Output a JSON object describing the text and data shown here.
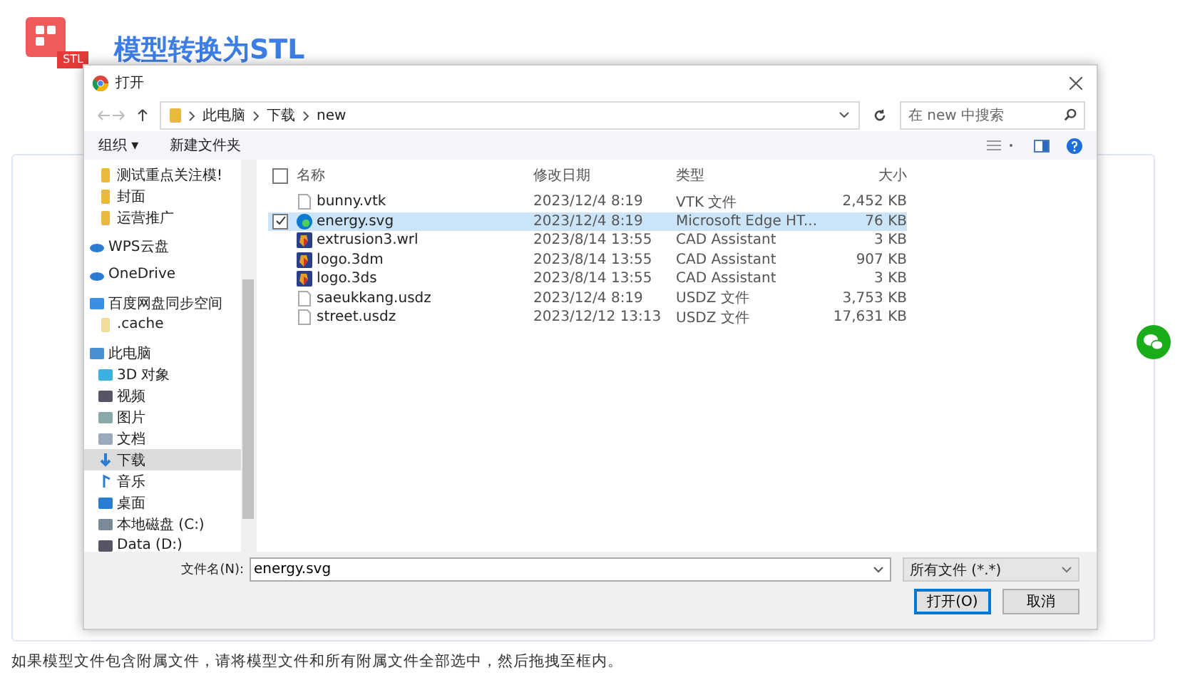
{
  "header": {
    "badge": "STL",
    "title": "模型转换为STL"
  },
  "dialog": {
    "title": "打开",
    "breadcrumb": [
      "此电脑",
      "下载",
      "new"
    ],
    "search": {
      "placeholder": "在 new 中搜索"
    },
    "toolbar": [
      "组织 ▾",
      "新建文件夹"
    ],
    "sidebar": [
      {
        "label": "测试重点关注模!",
        "kind": "folder",
        "selected": false
      },
      {
        "label": "封面",
        "kind": "folder",
        "selected": false
      },
      {
        "label": "运营推广",
        "kind": "folder",
        "selected": false
      },
      {
        "label": "WPS云盘",
        "kind": "cloud",
        "selected": false
      },
      {
        "label": "OneDrive",
        "kind": "cloud",
        "selected": false
      },
      {
        "label": "百度网盘同步空间",
        "kind": "sync",
        "selected": false,
        "children": [
          {
            "label": ".cache",
            "kind": "folder-light",
            "selected": false
          }
        ]
      },
      {
        "label": "此电脑",
        "kind": "pc",
        "selected": false,
        "children": [
          {
            "label": "3D 对象",
            "kind": "cube",
            "selected": false
          },
          {
            "label": "视频",
            "kind": "video",
            "selected": false
          },
          {
            "label": "图片",
            "kind": "image",
            "selected": false
          },
          {
            "label": "文档",
            "kind": "doc",
            "selected": false
          },
          {
            "label": "下载",
            "kind": "download",
            "selected": true
          },
          {
            "label": "音乐",
            "kind": "music",
            "selected": false
          },
          {
            "label": "桌面",
            "kind": "desktop",
            "selected": false
          },
          {
            "label": "本地磁盘 (C:)",
            "kind": "disk",
            "selected": false
          },
          {
            "label": "Data (D:)",
            "kind": "drive",
            "selected": false
          }
        ]
      }
    ],
    "all_checked": false,
    "columns": [
      "名称",
      "修改日期",
      "类型",
      "大小"
    ],
    "files": [
      {
        "name": "bunny.vtk",
        "date": "2023/12/4 8:19",
        "type": "VTK 文件",
        "size": "2,452 KB",
        "kind": "doc",
        "selected": false
      },
      {
        "name": "energy.svg",
        "date": "2023/12/4 8:19",
        "type": "Microsoft Edge HT...",
        "size": "76 KB",
        "kind": "edge",
        "selected": true
      },
      {
        "name": "extrusion3.wrl",
        "date": "2023/8/14 13:55",
        "type": "CAD Assistant",
        "size": "3 KB",
        "kind": "cad",
        "selected": false
      },
      {
        "name": "logo.3dm",
        "date": "2023/8/14 13:55",
        "type": "CAD Assistant",
        "size": "907 KB",
        "kind": "cad",
        "selected": false
      },
      {
        "name": "logo.3ds",
        "date": "2023/8/14 13:55",
        "type": "CAD Assistant",
        "size": "3 KB",
        "kind": "cad",
        "selected": false
      },
      {
        "name": "saeukkang.usdz",
        "date": "2023/12/4 8:19",
        "type": "USDZ 文件",
        "size": "3,753 KB",
        "kind": "doc",
        "selected": false
      },
      {
        "name": "street.usdz",
        "date": "2023/12/12 13:13",
        "type": "USDZ 文件",
        "size": "17,631 KB",
        "kind": "doc",
        "selected": false
      }
    ],
    "filename_label": "文件名(N):",
    "filename": "energy.svg",
    "filter": "所有文件 (*.*)",
    "buttons": [
      "打开(O)",
      "取消"
    ]
  },
  "caption": "如果模型文件包含附属文件，请将模型文件和所有附属文件全部选中，然后拖拽至框内。"
}
